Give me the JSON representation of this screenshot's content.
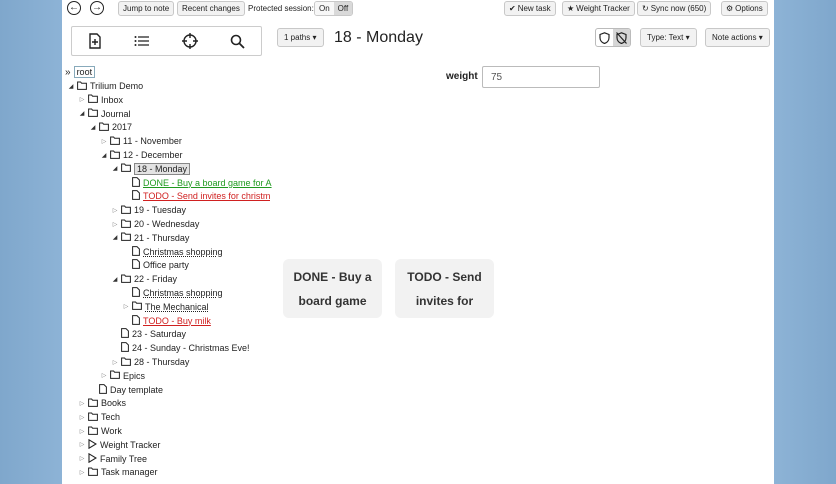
{
  "topbar": {
    "jump_label": "Jump to note",
    "recent_label": "Recent changes",
    "protected_label": "Protected session:",
    "on_label": "On",
    "off_label": "Off",
    "new_task_label": "New task",
    "weight_tracker_label": "Weight Tracker",
    "sync_label": "Sync now (650)",
    "options_label": "Options"
  },
  "note": {
    "paths_label": "1 paths",
    "title": "18 - Monday",
    "type_label": "Type: Text",
    "actions_label": "Note actions"
  },
  "attribute": {
    "label": "weight",
    "value": "75"
  },
  "tree": {
    "root": "root",
    "items": [
      {
        "label": "Trilium Demo"
      },
      {
        "label": "Inbox"
      },
      {
        "label": "Journal"
      },
      {
        "label": "2017"
      },
      {
        "label": "11 - November"
      },
      {
        "label": "12 - December"
      },
      {
        "label": "18 - Monday"
      },
      {
        "label": "DONE - Buy a board game for A"
      },
      {
        "label": "TODO - Send invites for christm"
      },
      {
        "label": "19 - Tuesday"
      },
      {
        "label": "20 - Wednesday"
      },
      {
        "label": "21 - Thursday"
      },
      {
        "label": "Christmas shopping"
      },
      {
        "label": "Office party"
      },
      {
        "label": "22 - Friday"
      },
      {
        "label": "Christmas shopping"
      },
      {
        "label": "The Mechanical"
      },
      {
        "label": "TODO - Buy milk"
      },
      {
        "label": "23 - Saturday"
      },
      {
        "label": "24 - Sunday - Christmas Eve!"
      },
      {
        "label": "28 - Thursday"
      },
      {
        "label": "Epics"
      },
      {
        "label": "Day template"
      },
      {
        "label": "Books"
      },
      {
        "label": "Tech"
      },
      {
        "label": "Work"
      },
      {
        "label": "Weight Tracker"
      },
      {
        "label": "Family Tree"
      },
      {
        "label": "Task manager"
      }
    ]
  },
  "cards": [
    {
      "text": "DONE - Buy a board game"
    },
    {
      "text": "TODO - Send invites for"
    }
  ],
  "colors": {
    "done": "#1f9a1f",
    "todo": "#d02020",
    "frame": "#8db3d6"
  }
}
